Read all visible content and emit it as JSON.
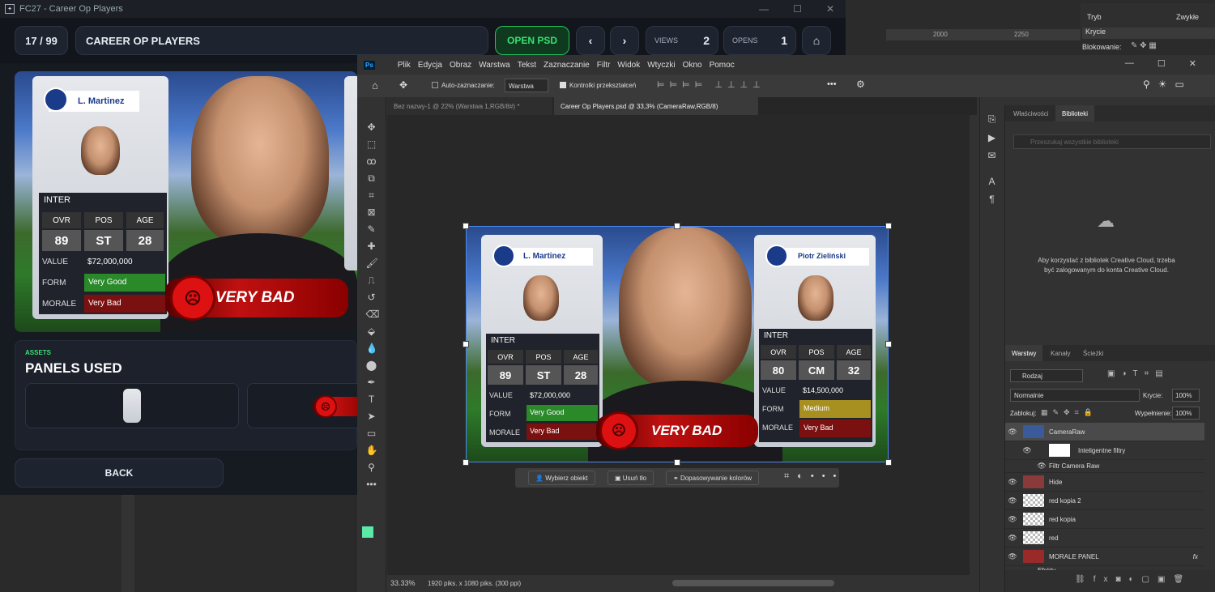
{
  "fc": {
    "window_title": "FC27 - Career Op Players",
    "counter": "17 / 99",
    "title": "CAREER OP PLAYERS",
    "open_psd": "OPEN PSD",
    "views_label": "VIEWS",
    "views_value": "2",
    "opens_label": "OPENS",
    "opens_value": "1",
    "assets_label": "ASSETS",
    "panels_title": "PANELS USED",
    "back": "BACK"
  },
  "card1": {
    "name": "L. Martinez",
    "club": "INTER",
    "ovr_label": "OVR",
    "pos_label": "POS",
    "age_label": "AGE",
    "ovr": "89",
    "pos": "ST",
    "age": "28",
    "value_label": "VALUE",
    "value": "$72,000,000",
    "form_label": "FORM",
    "form": "Very Good",
    "morale_label": "MORALE",
    "morale": "Very Bad"
  },
  "card2": {
    "name": "Piotr Zieliński",
    "club": "INTER",
    "ovr": "80",
    "pos": "CM",
    "age": "32",
    "value": "$14,500,000",
    "form": "Medium",
    "morale": "Very Bad"
  },
  "verdict": "VERY BAD",
  "ps": {
    "menu": [
      "Plik",
      "Edycja",
      "Obraz",
      "Warstwa",
      "Tekst",
      "Zaznaczanie",
      "Filtr",
      "Widok",
      "Wtyczki",
      "Okno",
      "Pomoc"
    ],
    "auto_select": "Auto-zaznaczanie:",
    "layer_select": "Warstwa",
    "transform_controls": "Kontrolki przekształceń",
    "tab1": "Bez nazwy-1 @ 22% (Warstwa 1,RGB/8#) *",
    "tab2": "Career Op Players.psd @ 33,3% (CameraRaw,RGB/8)",
    "ctx_select": "Wybierz obiekt",
    "ctx_remove": "Usuń tło",
    "ctx_match": "Dopasowywanie kolorów",
    "zoom": "33.33%",
    "doc_info": "1920 piks. x 1080 piks. (300 ppi)",
    "ruler_2000": "2000",
    "ruler_2250": "2250",
    "tab_props": "Właściwości",
    "tab_libs": "Biblioteki",
    "search_libs": "Przeszukaj wszystkie biblioteki",
    "cc_message": "Aby korzystać z bibliotek Creative Cloud, trzeba być zalogowanym do konta Creative Cloud.",
    "tab_layers": "Warstwy",
    "tab_channels": "Kanały",
    "tab_paths": "Ścieżki",
    "kind": "Rodzaj",
    "blend": "Normalnie",
    "opacity_label": "Krycie:",
    "opacity": "100%",
    "lock_label": "Zablokuj:",
    "fill_label": "Wypełnienie:",
    "fill": "100%",
    "top_mode_label": "Tryb",
    "top_mode_value": "Zwykłe",
    "top_opacity": "Krycie",
    "top_lock": "Blokowanie:",
    "layers": [
      "CameraRaw",
      "Inteligentne filtry",
      "Filtr Camera Raw",
      "Hide",
      "red kopia 2",
      "red kopia",
      "red",
      "MORALE PANEL",
      "Efekty"
    ]
  }
}
